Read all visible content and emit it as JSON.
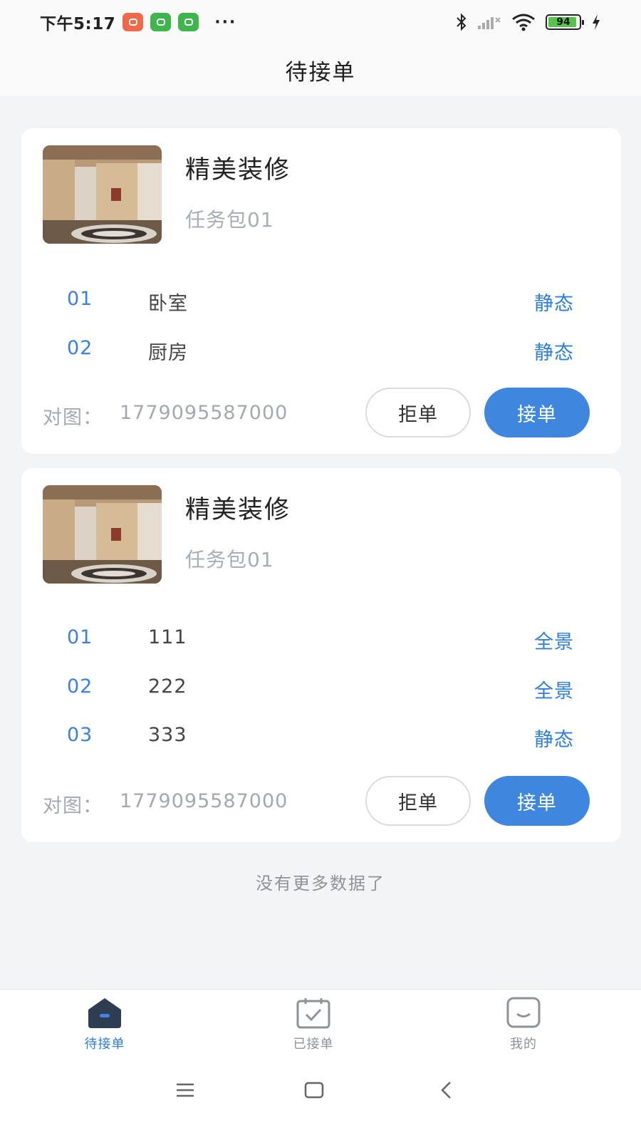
{
  "status_bar": {
    "time": "下午5:17",
    "more": "···",
    "battery_level": 94,
    "battery_label": "94",
    "app_icons": [
      "weibo-icon",
      "wechat-icon",
      "wechat-icon"
    ],
    "app_icon_colors": [
      "#ef6a4a",
      "#3fb54e",
      "#3fb54e"
    ]
  },
  "header": {
    "title": "待接单"
  },
  "orders": [
    {
      "title": "精美装修",
      "subtitle": "任务包01",
      "tasks": [
        {
          "index": "01",
          "name": "卧室",
          "type": "静态"
        },
        {
          "index": "02",
          "name": "厨房",
          "type": "静态"
        }
      ],
      "footer_label": "对图：",
      "footer_value": "1779095587000",
      "reject_label": "拒单",
      "accept_label": "接单"
    },
    {
      "title": "精美装修",
      "subtitle": "任务包01",
      "tasks": [
        {
          "index": "01",
          "name": "111",
          "type": "全景"
        },
        {
          "index": "02",
          "name": "222",
          "type": "全景"
        },
        {
          "index": "03",
          "name": "333",
          "type": "静态"
        }
      ],
      "footer_label": "对图：",
      "footer_value": "1779095587000",
      "reject_label": "拒单",
      "accept_label": "接单"
    }
  ],
  "list_end_text": "没有更多数据了",
  "tabbar": {
    "items": [
      {
        "label": "待接单",
        "icon": "home-icon",
        "active": true
      },
      {
        "label": "已接单",
        "icon": "calendar-check-icon",
        "active": false
      },
      {
        "label": "我的",
        "icon": "profile-face-icon",
        "active": false
      }
    ]
  },
  "colors": {
    "accent": "#3f86df",
    "tab_active": "#2f7fd8",
    "tab_inactive": "#8e939a",
    "page_bg": "#f3f4f6"
  }
}
